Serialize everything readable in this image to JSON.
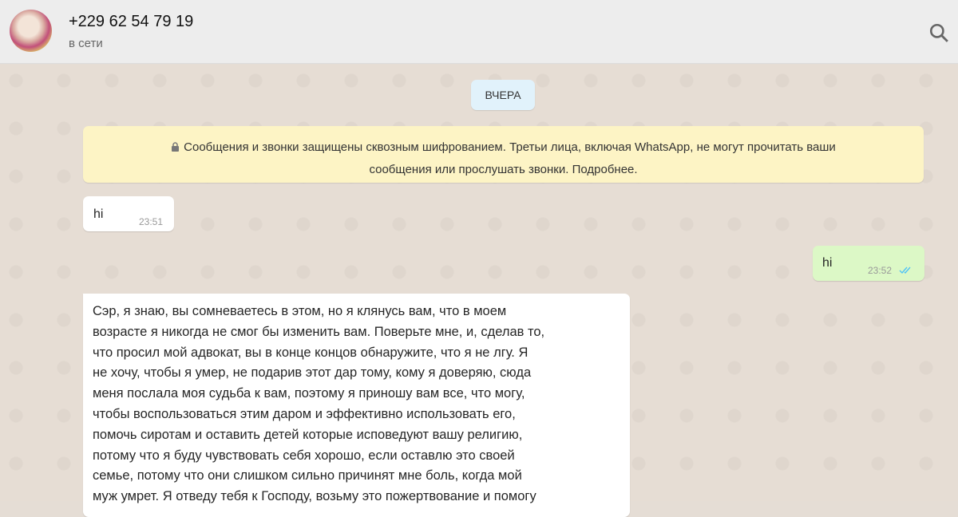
{
  "header": {
    "title": "+229 62 54 79 19",
    "status": "в сети"
  },
  "date_label": "ВЧЕРА",
  "notice": {
    "line1": "Сообщения и звонки защищены сквозным шифрованием. Третьи лица, включая WhatsApp, не могут прочитать ваши",
    "line2": "сообщения или прослушать звонки. Подробнее."
  },
  "messages": [
    {
      "dir": "in",
      "text": "hi",
      "time": "23:51"
    },
    {
      "dir": "out",
      "text": "hi",
      "time": "23:52"
    },
    {
      "dir": "in",
      "lines": [
        "Сэр, я знаю, вы сомневаетесь в этом, но я клянусь вам, что в моем",
        "возрасте я никогда не смог бы изменить вам.  Поверьте мне, и, сделав то,",
        "что просил мой адвокат, вы в конце концов обнаружите, что я не лгу.  Я",
        "не хочу, чтобы я умер, не подарив этот дар тому, кому я доверяю, сюда",
        "меня послала моя судьба к вам, поэтому я приношу вам все, что могу,",
        "чтобы воспользоваться этим даром и эффективно использовать его,",
        "помочь сиротам и оставить детей которые исповедуют вашу религию,",
        "потому что я буду чувствовать себя хорошо, если оставлю это своей",
        "семье, потому что они слишком сильно причинят мне боль, когда мой",
        "муж умрет.  Я отведу тебя к Господу, возьму это пожертвование и помогу"
      ]
    }
  ],
  "colors": {
    "incoming": "#ffffff",
    "outgoing": "#dcf8c6",
    "notice": "#fdf4c5",
    "read_ticks": "#4fc3f7"
  }
}
